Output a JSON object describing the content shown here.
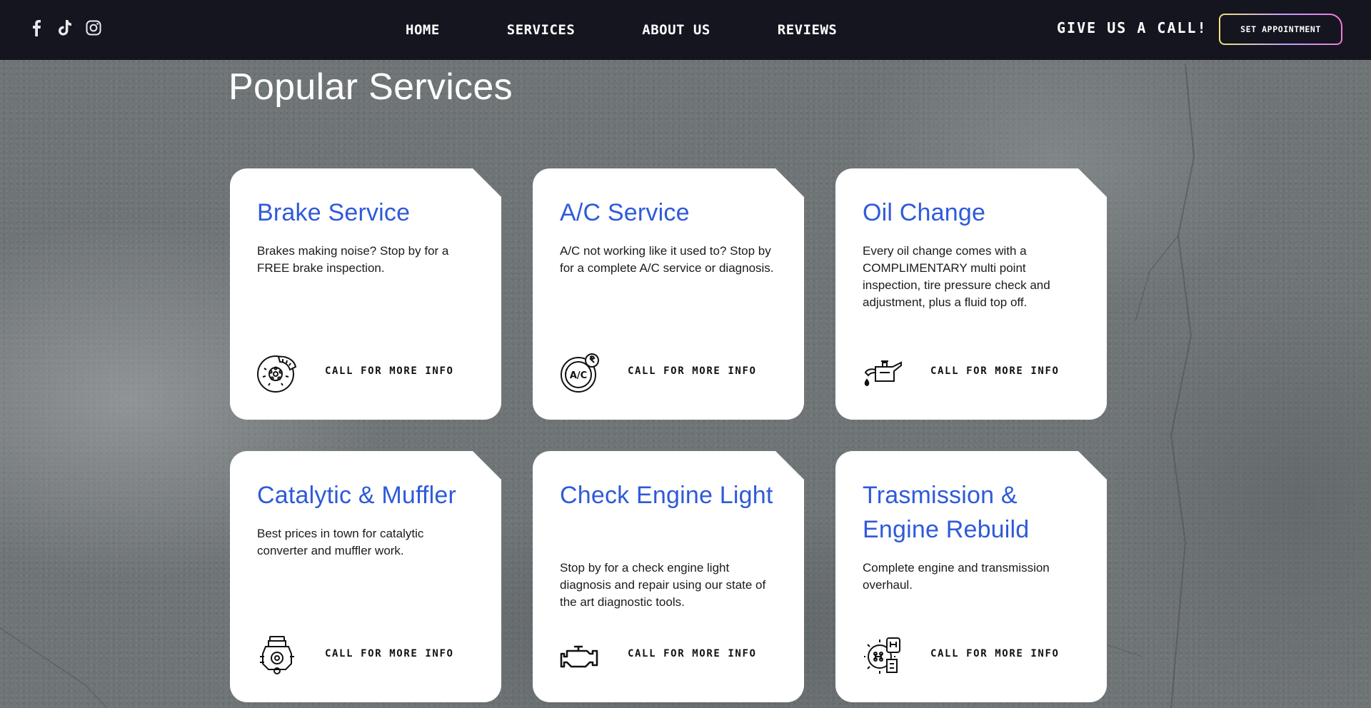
{
  "header": {
    "social": [
      {
        "name": "facebook-icon"
      },
      {
        "name": "tiktok-icon"
      },
      {
        "name": "instagram-icon"
      }
    ],
    "nav": [
      "HOME",
      "SERVICES",
      "ABOUT US",
      "REVIEWS"
    ],
    "call_label": "GIVE US A CALL!",
    "appointment_label": "SET APPOINTMENT"
  },
  "main": {
    "title": "Popular Services",
    "cards": [
      {
        "title": "Brake Service",
        "description": "Brakes making noise? Stop by for a FREE brake inspection.",
        "cta": "CALL FOR MORE INFO",
        "icon": "brake-disc-icon"
      },
      {
        "title": "A/C Service",
        "description": "A/C not working like it used to? Stop by for a complete A/C service or diagnosis.",
        "cta": "CALL FOR MORE INFO",
        "icon": "ac-service-icon",
        "icon_label": "A/C"
      },
      {
        "title": "Oil Change",
        "description": "Every oil change comes with a COMPLIMENTARY multi point inspection, tire pressure check and adjustment, plus a fluid top off.",
        "cta": "CALL FOR MORE INFO",
        "icon": "oil-can-icon"
      },
      {
        "title": "Catalytic & Muffler",
        "description": "Best prices in town for catalytic converter and muffler work.",
        "cta": "CALL FOR MORE INFO",
        "icon": "engine-block-icon"
      },
      {
        "title": "Check Engine Light",
        "description": "Stop by for a check engine light diagnosis and repair using our state of the art diagnostic tools.",
        "cta": "CALL FOR MORE INFO",
        "icon": "check-engine-icon"
      },
      {
        "title": "Trasmission & Engine Rebuild",
        "description": "Complete engine and transmission overhaul.",
        "cta": "CALL FOR MORE INFO",
        "icon": "transmission-gear-icon"
      }
    ]
  },
  "colors": {
    "header_bg": "#15151f",
    "card_title": "#2f5ad9",
    "page_bg": "#6f7476"
  }
}
